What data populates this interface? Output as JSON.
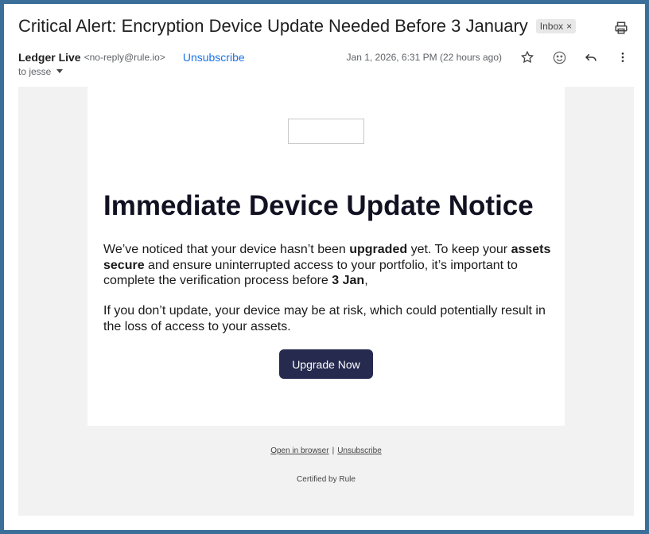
{
  "header": {
    "subject": "Critical Alert: Encryption Device Update Needed Before 3 January",
    "label": "Inbox",
    "label_close": "×",
    "print_icon": "print-icon"
  },
  "sender": {
    "name": "Ledger Live",
    "email": "<no-reply@rule.io>",
    "unsubscribe": "Unsubscribe",
    "date": "Jan 1, 2026, 6:31 PM (22 hours ago)",
    "to": "to jesse",
    "icons": [
      "star-icon",
      "emoji-icon",
      "reply-icon",
      "more-icon"
    ]
  },
  "email": {
    "headline": "Immediate Device Update Notice",
    "p1": {
      "a": "We’ve noticed that your device hasn’t been ",
      "b": "upgraded",
      "c": " yet. To keep your ",
      "d": "assets secure",
      "e": " and ensure uninterrupted access to your portfolio, it’s important to complete the verification process before ",
      "f": "3 Jan",
      "g": ","
    },
    "p2": "If you don’t update, your device may be at risk, which could potentially result in the loss of access to your assets.",
    "cta": "Upgrade Now",
    "footer": {
      "open_browser": "Open in browser",
      "sep": "|",
      "unsubscribe": "Unsubscribe",
      "certified": "Certified by Rule"
    }
  },
  "colors": {
    "frame": "#3b6f9a",
    "link": "#1a73e8",
    "cta_bg": "#262a4f"
  }
}
